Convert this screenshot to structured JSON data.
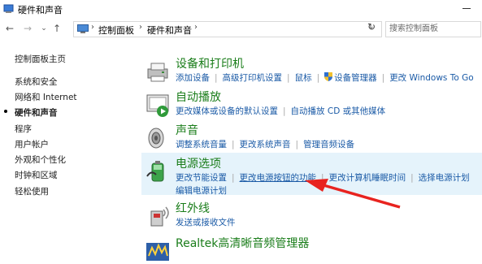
{
  "window": {
    "title": "硬件和声音"
  },
  "breadcrumb": [
    "控制面板",
    "硬件和声音"
  ],
  "search": {
    "placeholder": "搜索控制面板"
  },
  "sidebar": {
    "items": [
      {
        "label": "控制面板主页"
      },
      {
        "label": "系统和安全"
      },
      {
        "label": "网络和 Internet"
      },
      {
        "label": "硬件和声音",
        "current": true
      },
      {
        "label": "程序"
      },
      {
        "label": "用户帐户"
      },
      {
        "label": "外观和个性化"
      },
      {
        "label": "时钟和区域"
      },
      {
        "label": "轻松使用"
      }
    ]
  },
  "categories": [
    {
      "title": "设备和打印机",
      "icon": "printer-icon",
      "links": [
        "添加设备",
        "高级打印机设置",
        "鼠标",
        "设备管理器",
        "更改 Windows To Go"
      ]
    },
    {
      "title": "自动播放",
      "icon": "autoplay-icon",
      "links": [
        "更改媒体或设备的默认设置",
        "自动播放 CD 或其他媒体"
      ]
    },
    {
      "title": "声音",
      "icon": "speaker-icon",
      "links": [
        "调整系统音量",
        "更改系统声音",
        "管理音频设备"
      ]
    },
    {
      "title": "电源选项",
      "icon": "battery-icon",
      "links": [
        "更改节能设置",
        "更改电源按钮的功能",
        "更改计算机睡眠时间",
        "选择电源计划"
      ],
      "links2": [
        "编辑电源计划"
      ]
    },
    {
      "title": "红外线",
      "icon": "infrared-icon",
      "links": [
        "发送或接收文件"
      ]
    },
    {
      "title": "Realtek高清晰音频管理器",
      "icon": "realtek-icon",
      "links": []
    }
  ],
  "colors": {
    "link": "#1a5aa6",
    "heading": "#1a7d1a",
    "highlight": "#e5f3fb",
    "arrow": "#e8231f"
  }
}
